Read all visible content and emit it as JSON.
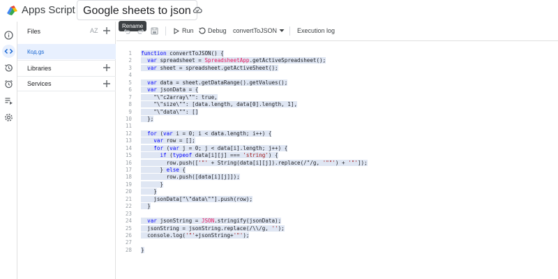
{
  "app": {
    "name": "Apps Script",
    "project_title": "Google sheets to json",
    "tooltip": "Rename"
  },
  "rail": {
    "icons": [
      "info-icon",
      "code-icon",
      "history-icon",
      "alarm-icon",
      "executions-icon",
      "settings-icon"
    ],
    "active": "code-icon"
  },
  "files": {
    "header": "Files",
    "sort_label": "AZ",
    "items": [
      "Код.gs"
    ],
    "libraries": "Libraries",
    "services": "Services"
  },
  "toolbar": {
    "run": "Run",
    "debug": "Debug",
    "function": "convertToJSON",
    "execution_log": "Execution log"
  },
  "editor": {
    "line_numbers": [
      "1",
      "2",
      "3",
      "4",
      "5",
      "6",
      "7",
      "8",
      "9",
      "10",
      "11",
      "12",
      "13",
      "14",
      "15",
      "16",
      "17",
      "18",
      "19",
      "20",
      "21",
      "22",
      "23",
      "24",
      "25",
      "26",
      "27",
      "28"
    ],
    "lines": [
      "function convertToJSON() {",
      "  var spreadsheet = SpreadsheetApp.getActiveSpreadsheet();",
      "  var sheet = spreadsheet.getActiveSheet();",
      "",
      "  var data = sheet.getDataRange().getValues();",
      "  var jsonData = {",
      "    \"\\\"c2array\\\"\": true,",
      "    \"\\\"size\\\"\": [data.length, data[0].length, 1],",
      "    \"\\\"data\\\"\": []",
      "  };",
      "",
      "  for (var i = 0; i < data.length; i++) {",
      "    var row = [];",
      "    for (var j = 0; j < data[i].length; j++) {",
      "      if (typeof data[i][j] === 'string') {",
      "        row.push(['\"' + String(data[i][j]).replace(/\"/g, '\"\"') + '\"']);",
      "      } else {",
      "        row.push([data[i][j]]);",
      "      }",
      "    }",
      "    jsonData[\"\\\"data\\\"\"].push(row);",
      "  }",
      "",
      "  var jsonString = JSON.stringify(jsonData);",
      "  jsonString = jsonString.replace(/\\\\/g, '');",
      "  console.log('\"'+jsonString+'\"');",
      "",
      "}"
    ]
  },
  "colors": {
    "accent": "#1967d2",
    "selected_bg": "#e8f0fe",
    "code_selection": "#dfe6f3",
    "keyword": "#0000ff",
    "string": "#a31515"
  }
}
